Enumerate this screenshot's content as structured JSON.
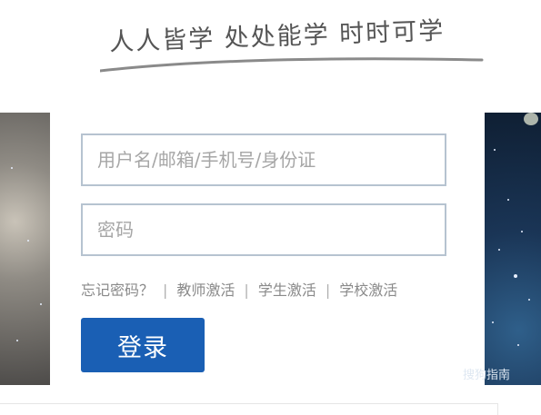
{
  "slogan": {
    "text": "人人皆学 处处能学 时时可学"
  },
  "login_form": {
    "username_placeholder": "用户名/邮箱/手机号/身份证",
    "password_placeholder": "密码",
    "links": [
      {
        "label": "忘记密码？"
      },
      {
        "label": "教师激活"
      },
      {
        "label": "学生激活"
      },
      {
        "label": "学校激活"
      }
    ],
    "separator": "|",
    "login_label": "登录"
  },
  "watermark": {
    "text": "搜狗指南",
    "icon": "S"
  },
  "colors": {
    "button": "#1a5fb4",
    "input_border": "#b6c3d0",
    "link_text": "#8a8a8a"
  }
}
